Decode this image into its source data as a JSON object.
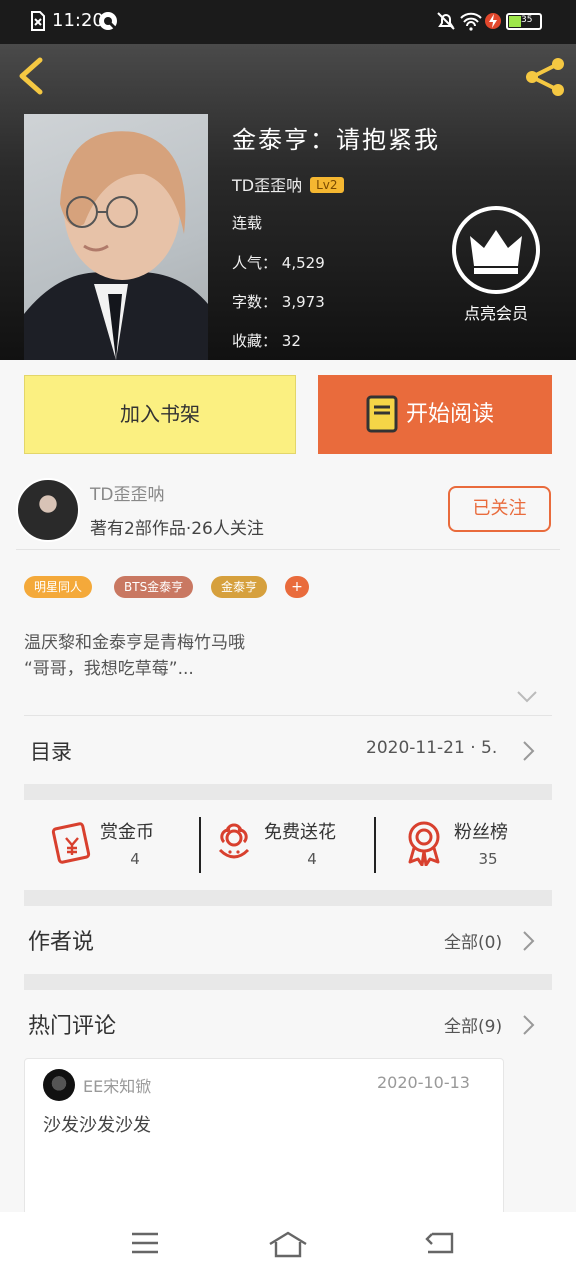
{
  "status_bar": {
    "time": "11:20",
    "battery": "35"
  },
  "book": {
    "title": "金泰亨：请抱紧我",
    "author": "TD歪歪呐",
    "level": "Lv2",
    "state": "连载",
    "popularity_label": "人气：",
    "popularity": "4,529",
    "words_label": "字数：",
    "words": "3,973",
    "favorites_label": "收藏：",
    "favorites": "32",
    "vip_label": "点亮会员"
  },
  "actions": {
    "shelf": "加入书架",
    "read": "开始阅读"
  },
  "author_row": {
    "name": "TD歪歪呐",
    "info": "著有2部作品·26人关注",
    "follow": "已关注"
  },
  "tags": [
    {
      "label": "明星同人",
      "color": "#f4a93a"
    },
    {
      "label": "BTS金泰亨",
      "color": "#c97862"
    },
    {
      "label": "金泰亨",
      "color": "#d6a03d"
    }
  ],
  "tag_add": "+",
  "synopsis": {
    "line1": "温厌黎和金泰亨是青梅竹马哦",
    "line2": "“哥哥，我想吃草莓”..."
  },
  "toc": {
    "label": "目录",
    "date": "2020-11-21 · 5."
  },
  "stats": [
    {
      "label": "赏金币",
      "value": "4"
    },
    {
      "label": "免费送花",
      "value": "4"
    },
    {
      "label": "粉丝榜",
      "value": "35"
    }
  ],
  "author_says": {
    "title": "作者说",
    "all": "全部(0)"
  },
  "hot_comments": {
    "title": "热门评论",
    "all": "全部(9)"
  },
  "comment": {
    "user": "EE宋知锨",
    "date": "2020-10-13",
    "text": "沙发沙发沙发"
  },
  "colors": {
    "accent": "#e96b3c",
    "shelf": "#fbf081"
  },
  "icons": [
    "back-icon",
    "share-icon",
    "crown-icon",
    "book-icon",
    "red-packet-icon",
    "flower-icon",
    "medal-icon",
    "menu-icon",
    "home-icon",
    "return-icon"
  ]
}
